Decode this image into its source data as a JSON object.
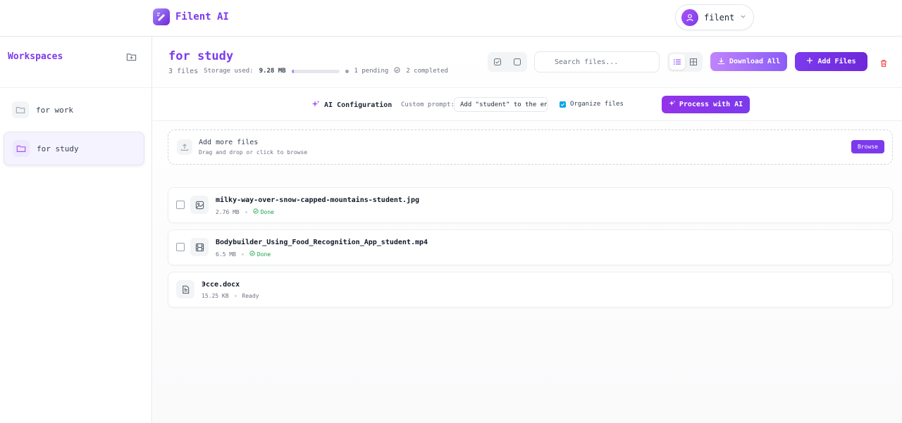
{
  "header": {
    "brand": "Filent AI",
    "user": "filent"
  },
  "sidebar": {
    "title": "Workspaces",
    "items": [
      {
        "label": "for work"
      },
      {
        "label": "for study"
      }
    ]
  },
  "workspace": {
    "title": "for study",
    "file_count": "3 files",
    "storage_label": "Storage used:",
    "storage_value": "9.28 MB",
    "storage_fraction": 0.05,
    "pending": "1 pending",
    "completed": "2 completed"
  },
  "toolbar": {
    "search_placeholder": "Search files...",
    "download_all": "Download All",
    "add_files": "Add Files"
  },
  "ai_config": {
    "title": "AI Configuration",
    "prompt_label": "Custom prompt:",
    "prompt_value": "Add \"student\" to the en",
    "organize_label": "Organize files",
    "process_button": "Process with AI"
  },
  "dropzone": {
    "title": "Add more files",
    "subtitle": "Drag and drop or click to browse",
    "browse": "Browse"
  },
  "files": [
    {
      "name": "milky-way-over-snow-capped-mountains-student.jpg",
      "size": "2.76 MB",
      "status": "Done",
      "icon": "image-icon"
    },
    {
      "name": "Bodybuilder_Using_Food_Recognition_App_student.mp4",
      "size": "6.5 MB",
      "status": "Done",
      "icon": "film-icon"
    },
    {
      "name": "Эссе.docx",
      "size": "15.25 KB",
      "status": "Ready",
      "icon": "document-icon"
    }
  ],
  "colors": {
    "accent": "#7c3aed",
    "success": "#16a34a",
    "danger": "#ef4444"
  }
}
